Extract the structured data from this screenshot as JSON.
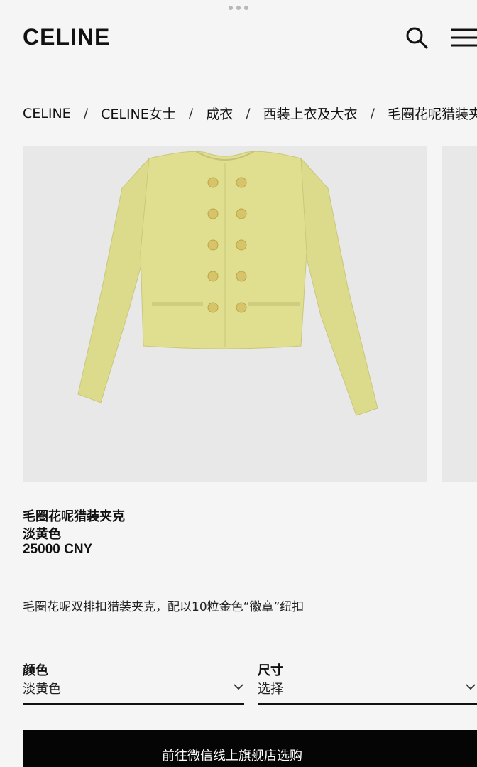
{
  "header": {
    "logo": "CELINE",
    "search_icon": "search-icon",
    "menu_icon": "hamburger-menu-icon"
  },
  "breadcrumb": {
    "items": [
      "CELINE",
      "CELINE女士",
      "成衣",
      "西装上衣及大衣",
      "毛圈花呢猎装夹"
    ],
    "separator": "/"
  },
  "product": {
    "name": "毛圈花呢猎装夹克",
    "color": "淡黄色",
    "price": "25000 CNY",
    "description": "毛圈花呢双排扣猎装夹克，配以10粒金色“徽章”纽扣",
    "image_color": "#dedd8a"
  },
  "selectors": {
    "color": {
      "label": "颜色",
      "value": "淡黄色"
    },
    "size": {
      "label": "尺寸",
      "value": "选择"
    }
  },
  "cta": {
    "label": "前往微信线上旗舰店选购"
  }
}
